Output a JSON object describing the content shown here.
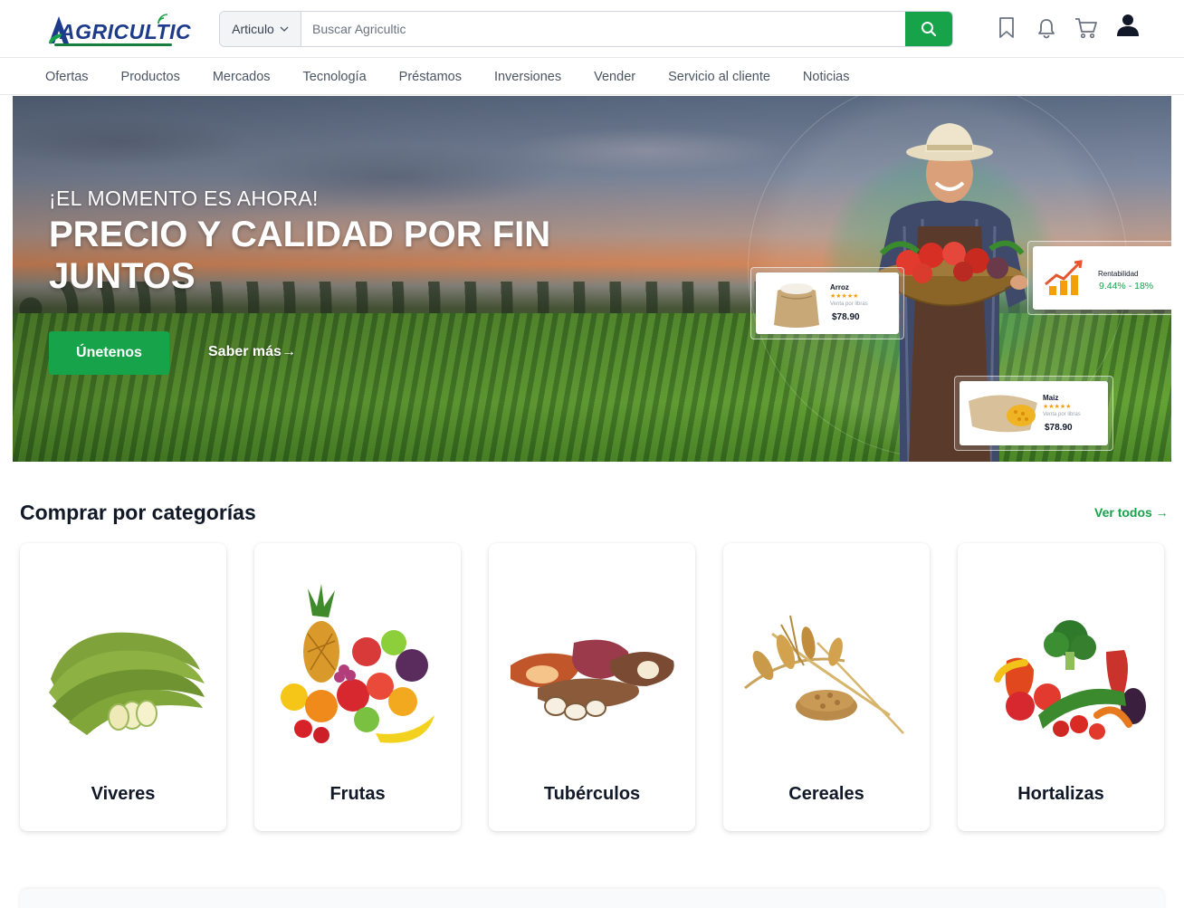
{
  "header": {
    "logo_text": "AGRICULTIC",
    "search": {
      "category": "Articulo",
      "placeholder": "Buscar Agricultic"
    },
    "icons": [
      "search-icon",
      "bookmark-icon",
      "bell-icon",
      "cart-icon",
      "user-icon"
    ]
  },
  "nav": {
    "items": [
      "Ofertas",
      "Productos",
      "Mercados",
      "Tecnología",
      "Préstamos",
      "Inversiones",
      "Vender",
      "Servicio al cliente",
      "Noticias"
    ]
  },
  "hero": {
    "kicker": "¡EL MOMENTO ES AHORA!",
    "title": "PRECIO Y CALIDAD POR FIN JUNTOS",
    "cta_primary": "Únetenos",
    "cta_secondary": "Saber más→",
    "cards": {
      "rice": {
        "name": "Arroz",
        "stars": "★★★★★",
        "sub": "Venta por libras",
        "price": "$78.90"
      },
      "corn": {
        "name": "Maiz",
        "stars": "★★★★★",
        "sub": "Venta por libras",
        "price": "$78.90"
      },
      "profit": {
        "label": "Rentabilidad",
        "value": "9.44% - 18%"
      }
    },
    "accent": "#16a34a"
  },
  "categories": {
    "heading": "Comprar por categorías",
    "view_all": "Ver todos →",
    "items": [
      {
        "label": "Viveres"
      },
      {
        "label": "Frutas"
      },
      {
        "label": "Tubérculos"
      },
      {
        "label": "Cereales"
      },
      {
        "label": "Hortalizas"
      }
    ]
  }
}
